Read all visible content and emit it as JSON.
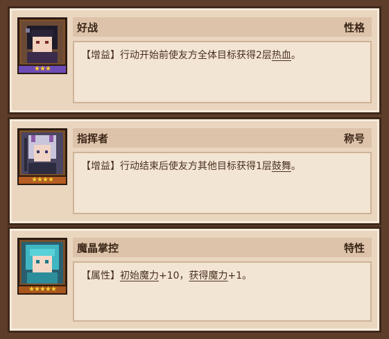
{
  "traits": [
    {
      "name": "好战",
      "category": "性格",
      "stars": "★★★",
      "desc_parts": [
        "【增益】行动开始前使友方全体目标获得2层",
        "热血",
        "。"
      ]
    },
    {
      "name": "指挥者",
      "category": "称号",
      "stars": "★★★★",
      "desc_parts": [
        "【增益】行动结束后使友方其他目标获得1层",
        "鼓舞",
        "。"
      ]
    },
    {
      "name": "魔晶掌控",
      "category": "特性",
      "stars": "★★★★★",
      "desc_parts": [
        "【属性】",
        "初始魔力",
        "+10，",
        "获得魔力",
        "+1。"
      ]
    }
  ]
}
